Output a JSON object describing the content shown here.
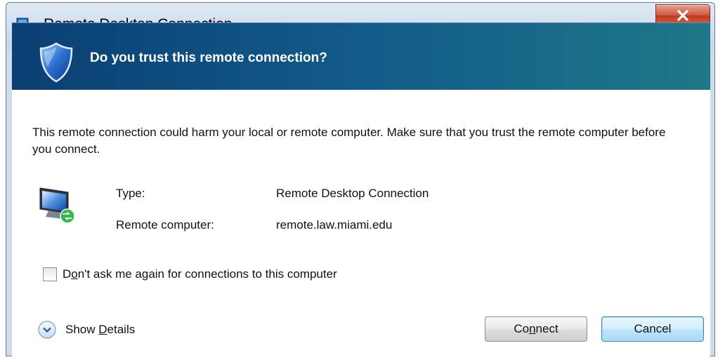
{
  "window": {
    "title": "Remote Desktop Connection",
    "close_glyph": "X"
  },
  "header": {
    "title": "Do you trust this remote connection?",
    "icon": "shield-icon"
  },
  "warning": {
    "text": "This remote connection could harm your local or remote computer. Make sure that you trust the remote computer before you connect."
  },
  "details": {
    "fields": [
      {
        "label": "Type:",
        "value": "Remote Desktop Connection"
      },
      {
        "label": "Remote computer:",
        "value": "remote.law.miami.edu"
      }
    ]
  },
  "checkbox": {
    "label_prefix": "D",
    "label_access": "o",
    "label_rest": "n't ask me again for connections to this computer",
    "checked": false
  },
  "show_details": {
    "label_access": "D",
    "label_rest": "etails",
    "label_prefix": "Show "
  },
  "buttons": {
    "connect": {
      "prefix": "Co",
      "access": "n",
      "rest": "nect"
    },
    "cancel": {
      "label": "Cancel"
    }
  },
  "colors": {
    "header_start": "#0a3f73",
    "header_end": "#1f7787",
    "close_button": "#c0391f",
    "default_button_border": "#3c7fb1"
  }
}
